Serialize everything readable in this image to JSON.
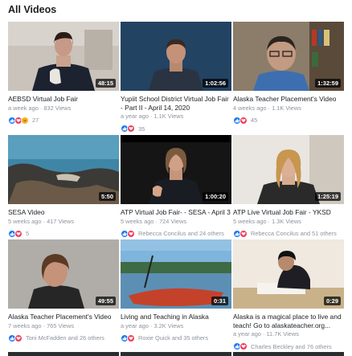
{
  "page": {
    "title": "All Videos"
  },
  "videos": [
    {
      "title": "AEBSD Virtual Job Fair",
      "meta": "a week ago · 832 Views",
      "duration": "48:15",
      "reactions": [
        "like",
        "love",
        "haha"
      ],
      "reaction_text": "27"
    },
    {
      "title": "Yupiit School District Virtual Job Fair - Part II - April 14, 2020",
      "meta": "a year ago · 1.1K Views",
      "duration": "1:02:56",
      "reactions": [
        "like",
        "love"
      ],
      "reaction_text": "35"
    },
    {
      "title": "Alaska Teacher Placement's Video",
      "meta": "4 weeks ago · 1.1K Views",
      "duration": "1:32:59",
      "reactions": [
        "like",
        "love"
      ],
      "reaction_text": "45"
    },
    {
      "title": "SESA Video",
      "meta": "5 weeks ago · 417 Views",
      "duration": "5:50",
      "reactions": [
        "like",
        "love"
      ],
      "reaction_text": "5"
    },
    {
      "title": "ATP Virtual Job Fair- - SESA - April 3",
      "meta": "5 weeks ago · 724 Views",
      "duration": "1:00:20",
      "reactions": [
        "like",
        "love"
      ],
      "reaction_text": "Rebecca Concilus and 24 others"
    },
    {
      "title": "ATP Live Virtual Job Fair - YKSD",
      "meta": "5 weeks ago · 1.3K Views",
      "duration": "1:25:19",
      "reactions": [
        "like",
        "love"
      ],
      "reaction_text": "Rebecca Concilus and 51 others"
    },
    {
      "title": "Alaska Teacher Placement's Video",
      "meta": "7 weeks ago · 765 Views",
      "duration": "49:55",
      "reactions": [
        "like",
        "love"
      ],
      "reaction_text": "Toni McFadden and 26 others"
    },
    {
      "title": "Living and Teaching in Alaska",
      "meta": "a year ago · 3.2K Views",
      "duration": "0:31",
      "reactions": [
        "like",
        "love"
      ],
      "reaction_text": "Roxie Quick and 35 others"
    },
    {
      "title": "Alaska is a magical place to live and teach! Go to alaskateacher.org...",
      "meta": "a year ago · 11.7K Views",
      "duration": "0:29",
      "reactions": [
        "like",
        "love"
      ],
      "reaction_text": "Charles Beckley and 76 others"
    }
  ],
  "colors": {
    "like": "#1877f2",
    "love": "#f33e58",
    "haha": "#f7b125",
    "meta": "#8d949e"
  },
  "icons": {
    "like": "thumbs-up-icon",
    "love": "heart-icon",
    "haha": "laugh-icon"
  }
}
